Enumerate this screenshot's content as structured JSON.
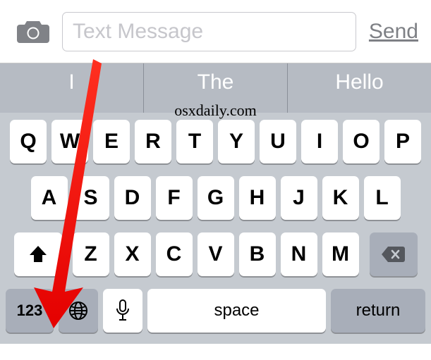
{
  "compose": {
    "placeholder": "Text Message",
    "send_label": "Send"
  },
  "suggestions": {
    "items": [
      "I",
      "The",
      "Hello"
    ]
  },
  "keyboard": {
    "row1": [
      "Q",
      "W",
      "E",
      "R",
      "T",
      "Y",
      "U",
      "I",
      "O",
      "P"
    ],
    "row2": [
      "A",
      "S",
      "D",
      "F",
      "G",
      "H",
      "J",
      "K",
      "L"
    ],
    "row3": [
      "Z",
      "X",
      "C",
      "V",
      "B",
      "N",
      "M"
    ],
    "numeric_label": "123",
    "space_label": "space",
    "return_label": "return"
  },
  "watermark": "osxdaily.com"
}
